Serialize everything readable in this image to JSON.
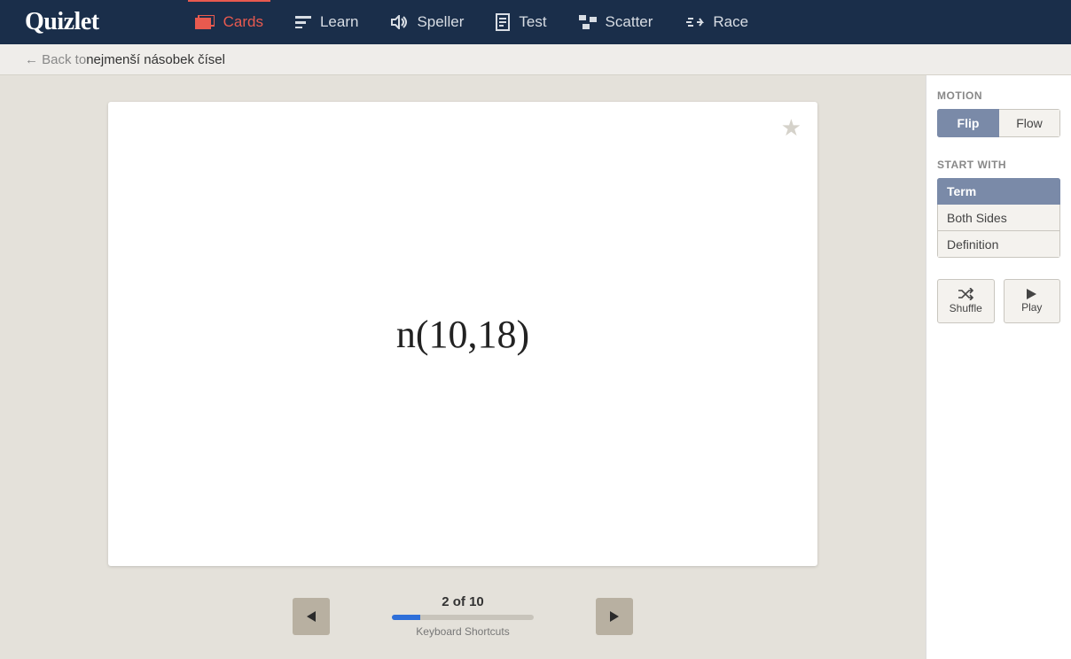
{
  "brand": "Quizlet",
  "nav": {
    "cards": "Cards",
    "learn": "Learn",
    "speller": "Speller",
    "test": "Test",
    "scatter": "Scatter",
    "race": "Race"
  },
  "breadcrumb": {
    "back_prefix": "← Back to ",
    "title": "nejmenší násobek čísel"
  },
  "card": {
    "term": "n(10,18)",
    "position_text": "2 of 10",
    "progress_percent": 20,
    "shortcuts_label": "Keyboard Shortcuts"
  },
  "sidebar": {
    "motion_label": "MOTION",
    "motion": {
      "flip": "Flip",
      "flow": "Flow"
    },
    "startwith_label": "START WITH",
    "startwith": {
      "term": "Term",
      "both": "Both Sides",
      "definition": "Definition"
    },
    "shuffle": "Shuffle",
    "play": "Play"
  }
}
